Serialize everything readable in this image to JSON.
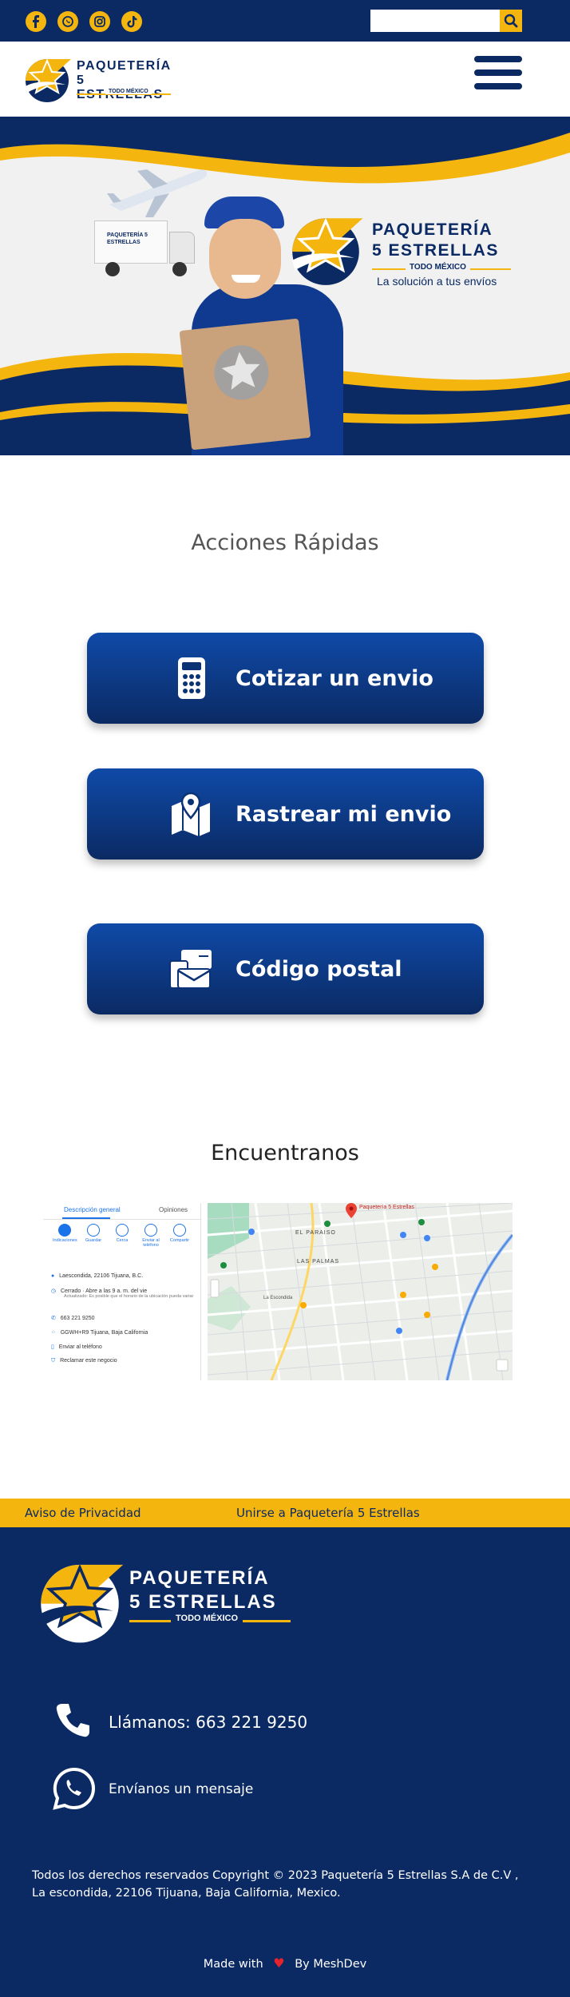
{
  "topbar": {
    "social": [
      {
        "name": "facebook-icon",
        "glyph": "f"
      },
      {
        "name": "whatsapp-icon",
        "glyph": ""
      },
      {
        "name": "instagram-icon",
        "glyph": ""
      },
      {
        "name": "tiktok-icon",
        "glyph": "♪"
      }
    ],
    "search": {
      "placeholder": "",
      "value": ""
    }
  },
  "brand": {
    "line1": "PAQUETERÍA",
    "line2": "5 ESTRELLAS",
    "line3": "TODO MÉXICO"
  },
  "hero": {
    "truck_text": "PAQUETERÍA 5 ESTRELLAS",
    "line1": "PAQUETERÍA",
    "line2": "5 ESTRELLAS",
    "line3": "TODO MÉXICO",
    "tagline": "La solución a tus envíos"
  },
  "quick_actions": {
    "title": "Acciones Rápidas",
    "buttons": [
      {
        "label": "Cotizar un envio",
        "icon": "calculator-icon"
      },
      {
        "label": "Rastrear mi envio",
        "icon": "map-pin-icon"
      },
      {
        "label": "Código postal",
        "icon": "mail-stack-icon"
      }
    ]
  },
  "location": {
    "title": "Encuentranos",
    "map_panel": {
      "tabs": [
        "Descripción general",
        "Opiniones"
      ],
      "actions": [
        "Indicaciones",
        "Guardar",
        "Cerca",
        "Enviar al teléfono",
        "Compartir"
      ],
      "address": "Laescondida, 22106 Tijuana, B.C.",
      "hours": "Cerrado · Abre a las 9 a. m. del vie",
      "hours_note": "Actualizado: Es posible que el horario de la ubicación pueda variar",
      "phone": "663 221 9250",
      "plus_code": "GGWH+R9 Tijuana, Baja California",
      "send": "Enviar al teléfono",
      "claim": "Reclamar este negocio"
    },
    "map_labels": [
      "Paquetería 5 Estrellas",
      "EL PARAISO",
      "LAS PALMAS",
      "La Escondida"
    ]
  },
  "footer": {
    "links": [
      "Aviso de Privacidad",
      "Unirse a Paquetería 5 Estrellas"
    ],
    "brand": {
      "line1": "PAQUETERÍA",
      "line2": "5 ESTRELLAS",
      "line3": "TODO MÉXICO"
    },
    "call": "Llámanos: 663 221 9250",
    "message": "Envíanos un mensaje",
    "copyright": "Todos los derechos reservados Copyright © 2023 Paquetería 5  Estrellas S.A de C.V ,",
    "address": "La escondida, 22106 Tijuana, Baja California, Mexico.",
    "made_with": "Made with",
    "by": "By MeshDev"
  },
  "colors": {
    "navy": "#0b2a63",
    "gold": "#f5b50f",
    "heart": "#e5232c"
  }
}
